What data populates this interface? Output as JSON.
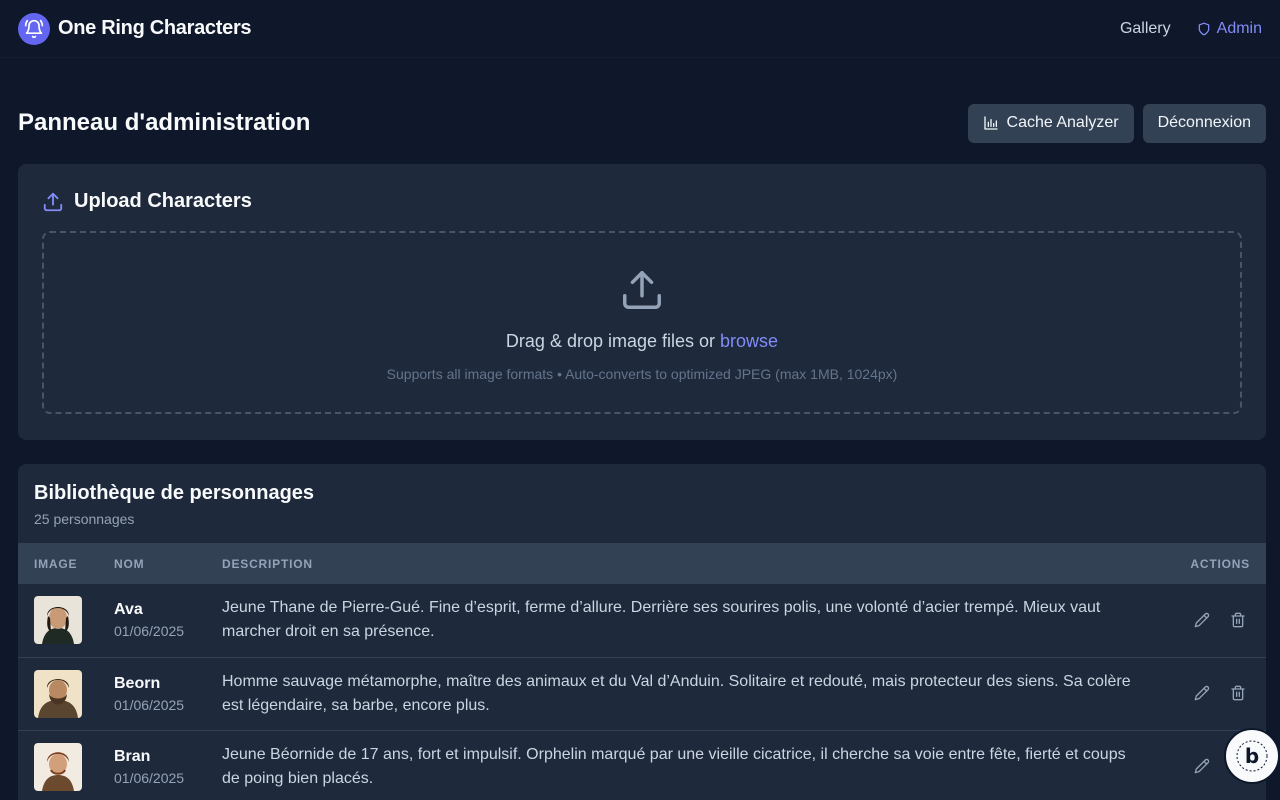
{
  "app": {
    "title": "One Ring Characters"
  },
  "nav": {
    "gallery": "Gallery",
    "admin": "Admin"
  },
  "page": {
    "title": "Panneau d'administration",
    "cache_button": "Cache Analyzer",
    "logout_button": "Déconnexion"
  },
  "upload": {
    "title": "Upload Characters",
    "drop_text": "Drag & drop image files or",
    "browse": "browse",
    "hint": "Supports all image formats • Auto-converts to optimized JPEG (max 1MB, 1024px)"
  },
  "library": {
    "title": "Bibliothèque de personnages",
    "count": "25 personnages",
    "columns": {
      "image": "Image",
      "name": "Nom",
      "description": "Description",
      "actions": "Actions"
    },
    "rows": [
      {
        "name": "Ava",
        "date": "01/06/2025",
        "description": "Jeune Thane de Pierre-Gué. Fine d’esprit, ferme d’allure. Derrière ses sourires polis, une volonté d’acier trempé. Mieux vaut marcher droit en sa présence."
      },
      {
        "name": "Beorn",
        "date": "01/06/2025",
        "description": "Homme sauvage métamorphe, maître des animaux et du Val d’Anduin. Solitaire et redouté, mais protecteur des siens. Sa colère est légendaire, sa barbe, encore plus."
      },
      {
        "name": "Bran",
        "date": "01/06/2025",
        "description": "Jeune Béornide de 17 ans, fort et impulsif. Orphelin marqué par une vieille cicatrice, il cherche sa voie entre fête, fierté et coups de poing bien placés."
      }
    ]
  },
  "colors": {
    "accent": "#818cf8",
    "brand": "#6366f1",
    "background": "#0f172a",
    "card": "#1e293b"
  },
  "icons": {
    "brand": "bell-icon",
    "admin": "shield-icon",
    "cache": "bar-chart-icon",
    "upload": "upload-icon",
    "edit": "pencil-icon",
    "delete": "trash-icon"
  }
}
